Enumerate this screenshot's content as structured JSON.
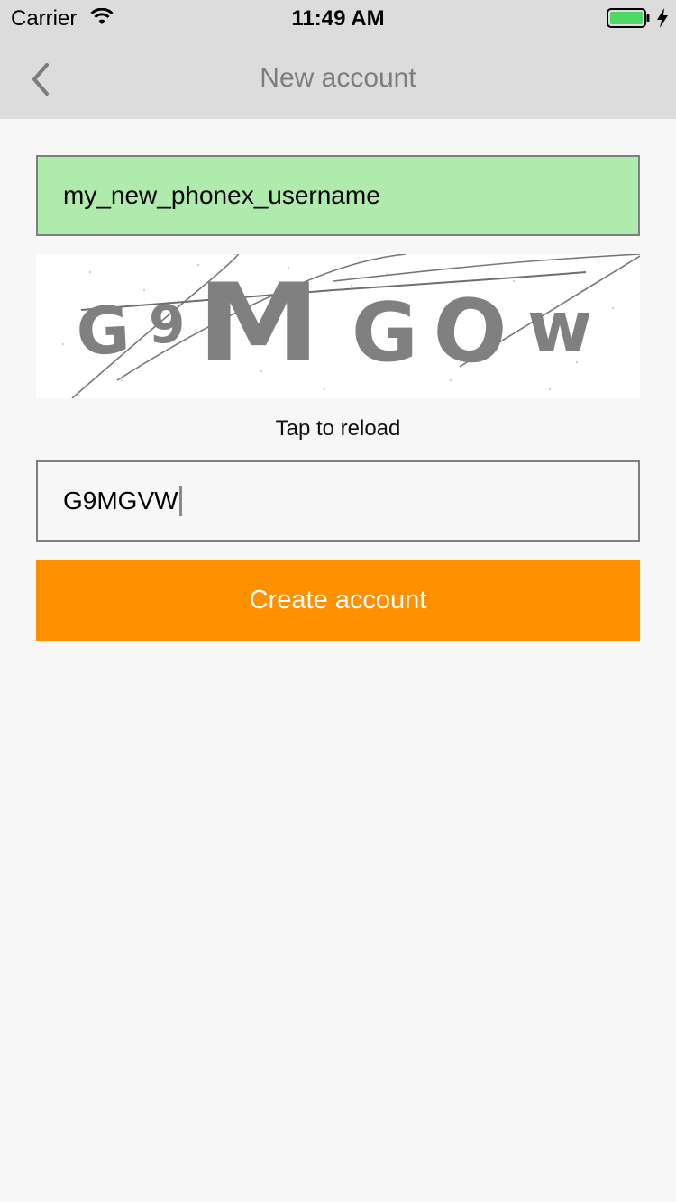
{
  "status_bar": {
    "carrier": "Carrier",
    "time": "11:49 AM",
    "icons": [
      "wifi-icon",
      "battery-icon",
      "charging-bolt-icon"
    ],
    "battery_color": "#4cd964"
  },
  "nav": {
    "title": "New account",
    "back_icon": "chevron-left-icon"
  },
  "form": {
    "username_value": "my_new_phonex_username",
    "username_bg": "#aeebad",
    "captcha_image_text": "G9MGVW",
    "reload_label": "Tap to reload",
    "captcha_value": "G9MGVW",
    "submit_label": "Create account",
    "submit_color": "#ff9000"
  }
}
